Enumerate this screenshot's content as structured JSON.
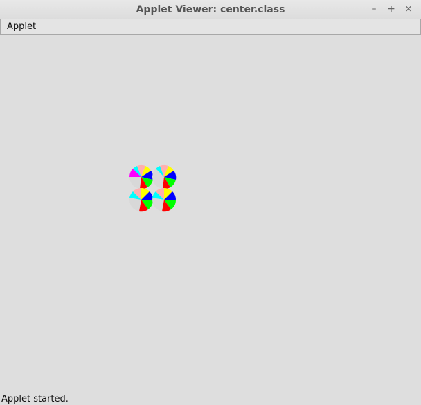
{
  "window": {
    "title": "Applet Viewer: center.class",
    "minimize_label": "–",
    "maximize_label": "+",
    "close_label": "×"
  },
  "menu": {
    "items": [
      {
        "label": "Applet"
      }
    ]
  },
  "status": {
    "text": "Applet started."
  },
  "applet": {
    "pie_count": 4,
    "slice_colors": [
      "#ffffff",
      "#00ffff",
      "#ffafaf",
      "#ffff00",
      "#0000ff",
      "#00ff00",
      "#ff0000",
      "#ff00ff",
      "#d8d8d8"
    ]
  }
}
